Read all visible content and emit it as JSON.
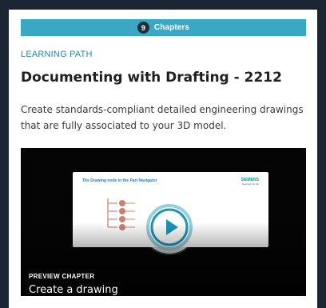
{
  "card": {
    "chapters_count": "9",
    "chapters_label": "Chapters",
    "eyebrow": "LEARNING PATH",
    "title": "Documenting with Drafting - 2212",
    "description": "Create standards-compliant detailed engineering drawings that are fully associated to your 3D model."
  },
  "video": {
    "slide_title": "The Drawing node in the Part Navigator",
    "brand": "SIEMENS",
    "tagline": "Ingenuity for life",
    "preview_label": "PREVIEW CHAPTER",
    "chapter_title": "Create a drawing"
  },
  "icons": {
    "play": "play-icon",
    "tree": "tree-node-icon"
  },
  "colors": {
    "page_bg": "#1b2533",
    "card_bg": "#ffffff",
    "chapter_bar": "#3aa7c4",
    "eyebrow": "#2b86a7",
    "title": "#1f1f1f",
    "description": "#3a3a3a",
    "play_accent": "#1d96b8"
  }
}
